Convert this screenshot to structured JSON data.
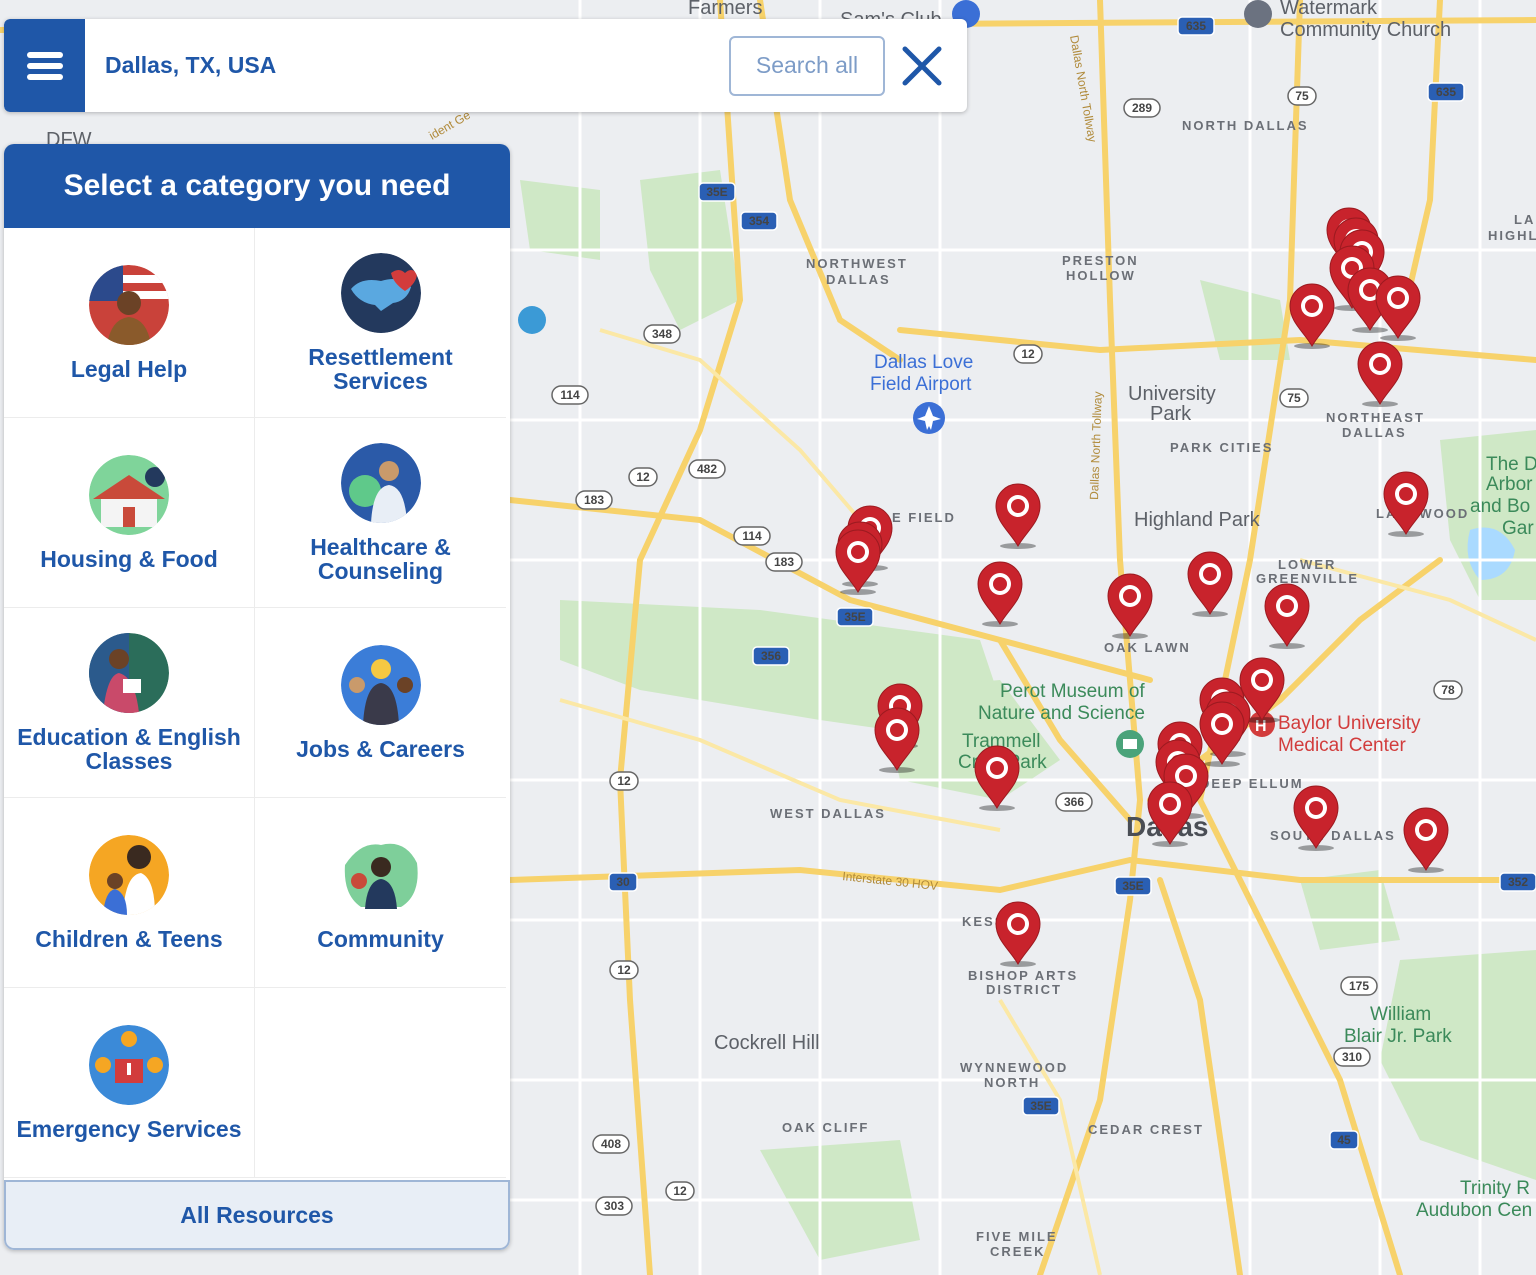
{
  "search": {
    "value": "Dallas, TX, USA",
    "search_all_label": "Search all"
  },
  "panel": {
    "title": "Select a category you need",
    "categories": [
      {
        "label": "Legal Help",
        "icon": "legal-help-icon",
        "color": "#c9423a"
      },
      {
        "label": "Resettlement Services",
        "icon": "resettlement-icon",
        "color": "#23395d"
      },
      {
        "label": "Housing & Food",
        "icon": "housing-food-icon",
        "color": "#6fcf8a"
      },
      {
        "label": "Healthcare & Counseling",
        "icon": "healthcare-icon",
        "color": "#2b5aa8"
      },
      {
        "label": "Education & English Classes",
        "icon": "education-icon",
        "color": "#2b6d5a"
      },
      {
        "label": "Jobs & Careers",
        "icon": "jobs-icon",
        "color": "#3b7dd8"
      },
      {
        "label": "Children & Teens",
        "icon": "children-icon",
        "color": "#f5a623"
      },
      {
        "label": "Community",
        "icon": "community-icon",
        "color": "#7ecf9a"
      },
      {
        "label": "Emergency Services",
        "icon": "emergency-icon",
        "color": "#3b8ad8"
      }
    ],
    "all_resources_label": "All Resources"
  },
  "map": {
    "labels": {
      "farmers": "Farmers",
      "watermark": "Watermark",
      "community_church": "Community Church",
      "dfw": "DFW",
      "north_dallas": "NORTH DALLAS",
      "northwest": "NORTHWEST",
      "northwest2": "DALLAS",
      "preston": "PRESTON",
      "preston2": "HOLLOW",
      "love_field": "Dallas Love",
      "love_field2": "Field Airport",
      "university": "University",
      "university2": "Park",
      "park_cities": "PARK CITIES",
      "northeast": "NORTHEAST",
      "northeast2": "DALLAS",
      "highland_park": "Highland Park",
      "field": "E FIELD",
      "lower": "LOWER",
      "greenville": "GREENVILLE",
      "oak_lawn": "OAK LAWN",
      "perot": "Perot Museum of",
      "perot2": "Nature and Science",
      "trammell": "Trammell",
      "crow_park": "Crow Park",
      "baylor": "Baylor University",
      "baylor2": "Medical Center",
      "deep_ellum": "DEEP ELLUM",
      "west_dallas": "WEST DALLAS",
      "dallas": "Dallas",
      "south_dallas": "SOUTH DALLAS",
      "interstate": "Interstate 30 HOV",
      "kessler": "KESSLER",
      "bishop": "BISHOP ARTS",
      "bishop2": "DISTRICT",
      "cockrell": "Cockrell Hill",
      "wynnewood": "WYNNEWOOD",
      "wynnewood2": "NORTH",
      "oak_cliff": "OAK CLIFF",
      "cedar_crest": "CEDAR CREST",
      "william": "William",
      "william2": "Blair Jr. Park",
      "five_mile": "FIVE MILE",
      "five_mile2": "CREEK",
      "trinity": "Trinity R",
      "audubon": "Audubon Cen",
      "arbor": "The D",
      "arbor2": "Arbor",
      "arbor3": "and Bo",
      "arbor4": "Gar",
      "lakewood": "LAKEWOOD",
      "la_high": "LA",
      "la_high2": "HIGHL",
      "tollway": "Dallas North Tollway",
      "tollway2": "Dallas North Tollway",
      "sams": "Sam's Club",
      "resident": "ident Ge"
    },
    "shields": [
      "635",
      "289",
      "75",
      "635",
      "35E",
      "354",
      "348",
      "114",
      "12",
      "482",
      "183",
      "114",
      "183",
      "35E",
      "356",
      "12",
      "75",
      "12",
      "78",
      "366",
      "35E",
      "30",
      "12",
      "175",
      "310",
      "45",
      "408",
      "303",
      "12",
      "35E",
      "352"
    ],
    "pin_color": "#c8232c"
  }
}
